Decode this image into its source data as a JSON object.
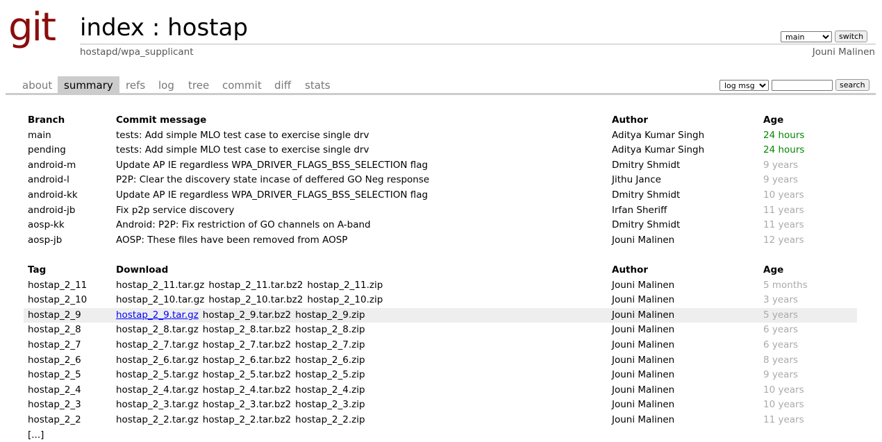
{
  "header": {
    "logo": "git",
    "title": "index : hostap",
    "description": "hostapd/wpa_supplicant",
    "owner": "Jouni Malinen",
    "branch_select": "main",
    "switch_label": "switch"
  },
  "tabs": [
    "about",
    "summary",
    "refs",
    "log",
    "tree",
    "commit",
    "diff",
    "stats"
  ],
  "active_tab": "summary",
  "search": {
    "type_select": "log msg",
    "query": "",
    "button": "search"
  },
  "branches": {
    "headers": [
      "Branch",
      "Commit message",
      "Author",
      "Age"
    ],
    "rows": [
      {
        "name": "main",
        "message": "tests: Add simple MLO test case to exercise single drv",
        "author": "Aditya Kumar Singh",
        "age": "24 hours",
        "recent": true
      },
      {
        "name": "pending",
        "message": "tests: Add simple MLO test case to exercise single drv",
        "author": "Aditya Kumar Singh",
        "age": "24 hours",
        "recent": true
      },
      {
        "name": "android-m",
        "message": "Update AP IE regardless WPA_DRIVER_FLAGS_BSS_SELECTION flag",
        "author": "Dmitry Shmidt",
        "age": "9 years",
        "recent": false
      },
      {
        "name": "android-l",
        "message": "P2P: Clear the discovery state incase of deffered GO Neg response",
        "author": "Jithu Jance",
        "age": "9 years",
        "recent": false
      },
      {
        "name": "android-kk",
        "message": "Update AP IE regardless WPA_DRIVER_FLAGS_BSS_SELECTION flag",
        "author": "Dmitry Shmidt",
        "age": "10 years",
        "recent": false
      },
      {
        "name": "android-jb",
        "message": "Fix p2p service discovery",
        "author": "Irfan Sheriff",
        "age": "11 years",
        "recent": false
      },
      {
        "name": "aosp-kk",
        "message": "Android: P2P: Fix restriction of GO channels on A-band",
        "author": "Dmitry Shmidt",
        "age": "11 years",
        "recent": false
      },
      {
        "name": "aosp-jb",
        "message": "AOSP: These files have been removed from AOSP",
        "author": "Jouni Malinen",
        "age": "12 years",
        "recent": false
      }
    ]
  },
  "tags": {
    "headers": [
      "Tag",
      "Download",
      "Author",
      "Age"
    ],
    "rows": [
      {
        "name": "hostap_2_11",
        "downloads": [
          "hostap_2_11.tar.gz",
          "hostap_2_11.tar.bz2",
          "hostap_2_11.zip"
        ],
        "author": "Jouni Malinen",
        "age": "5 months"
      },
      {
        "name": "hostap_2_10",
        "downloads": [
          "hostap_2_10.tar.gz",
          "hostap_2_10.tar.bz2",
          "hostap_2_10.zip"
        ],
        "author": "Jouni Malinen",
        "age": "3 years"
      },
      {
        "name": "hostap_2_9",
        "downloads": [
          "hostap_2_9.tar.gz",
          "hostap_2_9.tar.bz2",
          "hostap_2_9.zip"
        ],
        "author": "Jouni Malinen",
        "age": "5 years",
        "hovered": true
      },
      {
        "name": "hostap_2_8",
        "downloads": [
          "hostap_2_8.tar.gz",
          "hostap_2_8.tar.bz2",
          "hostap_2_8.zip"
        ],
        "author": "Jouni Malinen",
        "age": "6 years"
      },
      {
        "name": "hostap_2_7",
        "downloads": [
          "hostap_2_7.tar.gz",
          "hostap_2_7.tar.bz2",
          "hostap_2_7.zip"
        ],
        "author": "Jouni Malinen",
        "age": "6 years"
      },
      {
        "name": "hostap_2_6",
        "downloads": [
          "hostap_2_6.tar.gz",
          "hostap_2_6.tar.bz2",
          "hostap_2_6.zip"
        ],
        "author": "Jouni Malinen",
        "age": "8 years"
      },
      {
        "name": "hostap_2_5",
        "downloads": [
          "hostap_2_5.tar.gz",
          "hostap_2_5.tar.bz2",
          "hostap_2_5.zip"
        ],
        "author": "Jouni Malinen",
        "age": "9 years"
      },
      {
        "name": "hostap_2_4",
        "downloads": [
          "hostap_2_4.tar.gz",
          "hostap_2_4.tar.bz2",
          "hostap_2_4.zip"
        ],
        "author": "Jouni Malinen",
        "age": "10 years"
      },
      {
        "name": "hostap_2_3",
        "downloads": [
          "hostap_2_3.tar.gz",
          "hostap_2_3.tar.bz2",
          "hostap_2_3.zip"
        ],
        "author": "Jouni Malinen",
        "age": "10 years"
      },
      {
        "name": "hostap_2_2",
        "downloads": [
          "hostap_2_2.tar.gz",
          "hostap_2_2.tar.bz2",
          "hostap_2_2.zip"
        ],
        "author": "Jouni Malinen",
        "age": "11 years"
      }
    ]
  },
  "more_link": "[...]",
  "colors": {
    "logo": "#8b0d0d",
    "recent_age": "#008800",
    "old_age": "#aaaaaa",
    "active_tab_bg": "#cccccc",
    "link": "#0000ff"
  }
}
